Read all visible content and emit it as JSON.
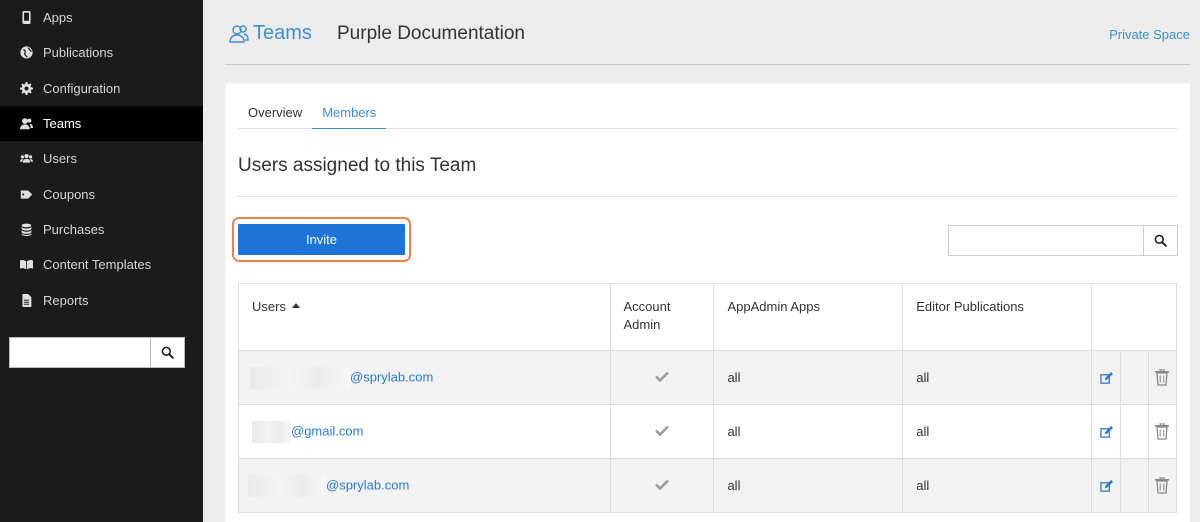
{
  "sidebar": {
    "items": [
      {
        "label": "Apps",
        "icon": "tablet-icon"
      },
      {
        "label": "Publications",
        "icon": "globe-icon"
      },
      {
        "label": "Configuration",
        "icon": "gear-icon"
      },
      {
        "label": "Teams",
        "icon": "team-icon",
        "active": true
      },
      {
        "label": "Users",
        "icon": "users-icon"
      },
      {
        "label": "Coupons",
        "icon": "tag-icon"
      },
      {
        "label": "Purchases",
        "icon": "database-icon"
      },
      {
        "label": "Content Templates",
        "icon": "book-icon"
      },
      {
        "label": "Reports",
        "icon": "file-icon"
      }
    ],
    "search_placeholder": ""
  },
  "header": {
    "section_link": "Teams",
    "page_title": "Purple Documentation",
    "right_link": "Private Space"
  },
  "tabs": [
    {
      "label": "Overview",
      "active": false
    },
    {
      "label": "Members",
      "active": true
    }
  ],
  "section_title": "Users assigned to this Team",
  "invite_label": "Invite",
  "search": {
    "placeholder": ""
  },
  "table": {
    "columns": [
      "Users",
      "Account Admin",
      "AppAdmin Apps",
      "Editor Publications"
    ],
    "sort_column": "Users",
    "rows": [
      {
        "email": "@sprylab.com",
        "account_admin": true,
        "appadmin_apps": "all",
        "editor_publications": "all"
      },
      {
        "email": "@gmail.com",
        "account_admin": true,
        "appadmin_apps": "all",
        "editor_publications": "all"
      },
      {
        "email": "@sprylab.com",
        "account_admin": true,
        "appadmin_apps": "all",
        "editor_publications": "all"
      }
    ]
  },
  "colors": {
    "accent": "#3b8fd8",
    "primary_button": "#1f74d8",
    "highlight_border": "#f0804e",
    "sidebar_bg": "#1b1b1b"
  }
}
